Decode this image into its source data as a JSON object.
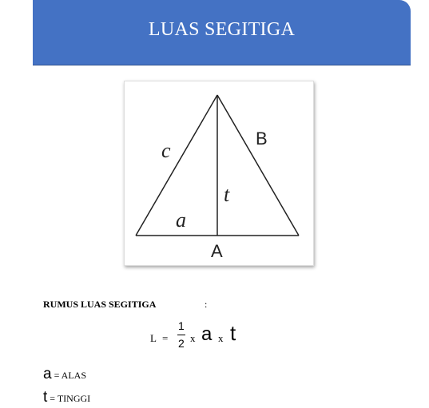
{
  "banner": {
    "title": "LUAS SEGITIGA",
    "color": "#4472c4"
  },
  "figure": {
    "label_c": "c",
    "label_B": "B",
    "label_t": "t",
    "label_a": "a",
    "label_A": "A"
  },
  "rumus": {
    "title": "RUMUS LUAS SEGITIGA",
    "colon": ":",
    "formula": {
      "L": "L",
      "eq": "=",
      "numerator": "1",
      "denominator": "2",
      "x1": "x",
      "a": "a",
      "x2": "x",
      "t": "t"
    }
  },
  "definitions": [
    {
      "symbol": "a",
      "text": " = ALAS"
    },
    {
      "symbol": "t",
      "text": " = TINGGI"
    }
  ]
}
